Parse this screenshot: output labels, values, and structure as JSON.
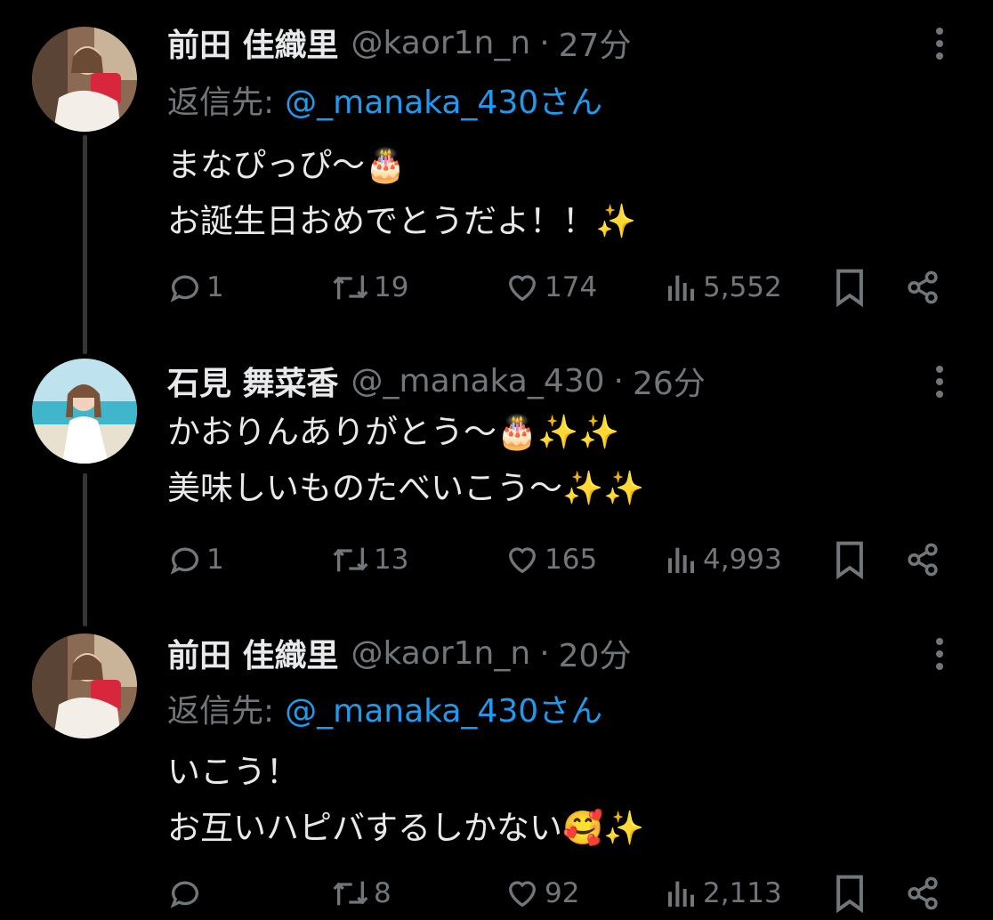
{
  "tweets": [
    {
      "name": "前田 佳織里",
      "handle": "@kaor1n_n",
      "separator": "·",
      "time": "27分",
      "reply_label": "返信先:",
      "reply_mention": "@_manaka_430さん",
      "lines": [
        "まなぴっぴ〜🎂",
        "お誕生日おめでとうだよ！！✨"
      ],
      "replies": "1",
      "retweets": "19",
      "likes": "174",
      "views": "5,552"
    },
    {
      "name": "石見 舞菜香",
      "handle": "@_manaka_430",
      "separator": "·",
      "time": "26分",
      "lines": [
        "かおりんありがとう〜🎂✨✨",
        "美味しいものたべいこう〜✨✨"
      ],
      "replies": "1",
      "retweets": "13",
      "likes": "165",
      "views": "4,993"
    },
    {
      "name": "前田 佳織里",
      "handle": "@kaor1n_n",
      "separator": "·",
      "time": "20分",
      "reply_label": "返信先:",
      "reply_mention": "@_manaka_430さん",
      "lines": [
        "いこう！",
        "お互いハピバするしかない🥰✨"
      ],
      "replies": "",
      "retweets": "8",
      "likes": "92",
      "views": "2,113"
    }
  ],
  "colors": {
    "background": "#000000",
    "primary_text": "#e7e9ea",
    "secondary_text": "#71767b",
    "mention": "#1d9bf0",
    "thread_line": "#333639"
  },
  "icons": [
    "reply-icon",
    "retweet-icon",
    "like-icon",
    "views-icon",
    "bookmark-icon",
    "share-icon",
    "more-icon"
  ]
}
